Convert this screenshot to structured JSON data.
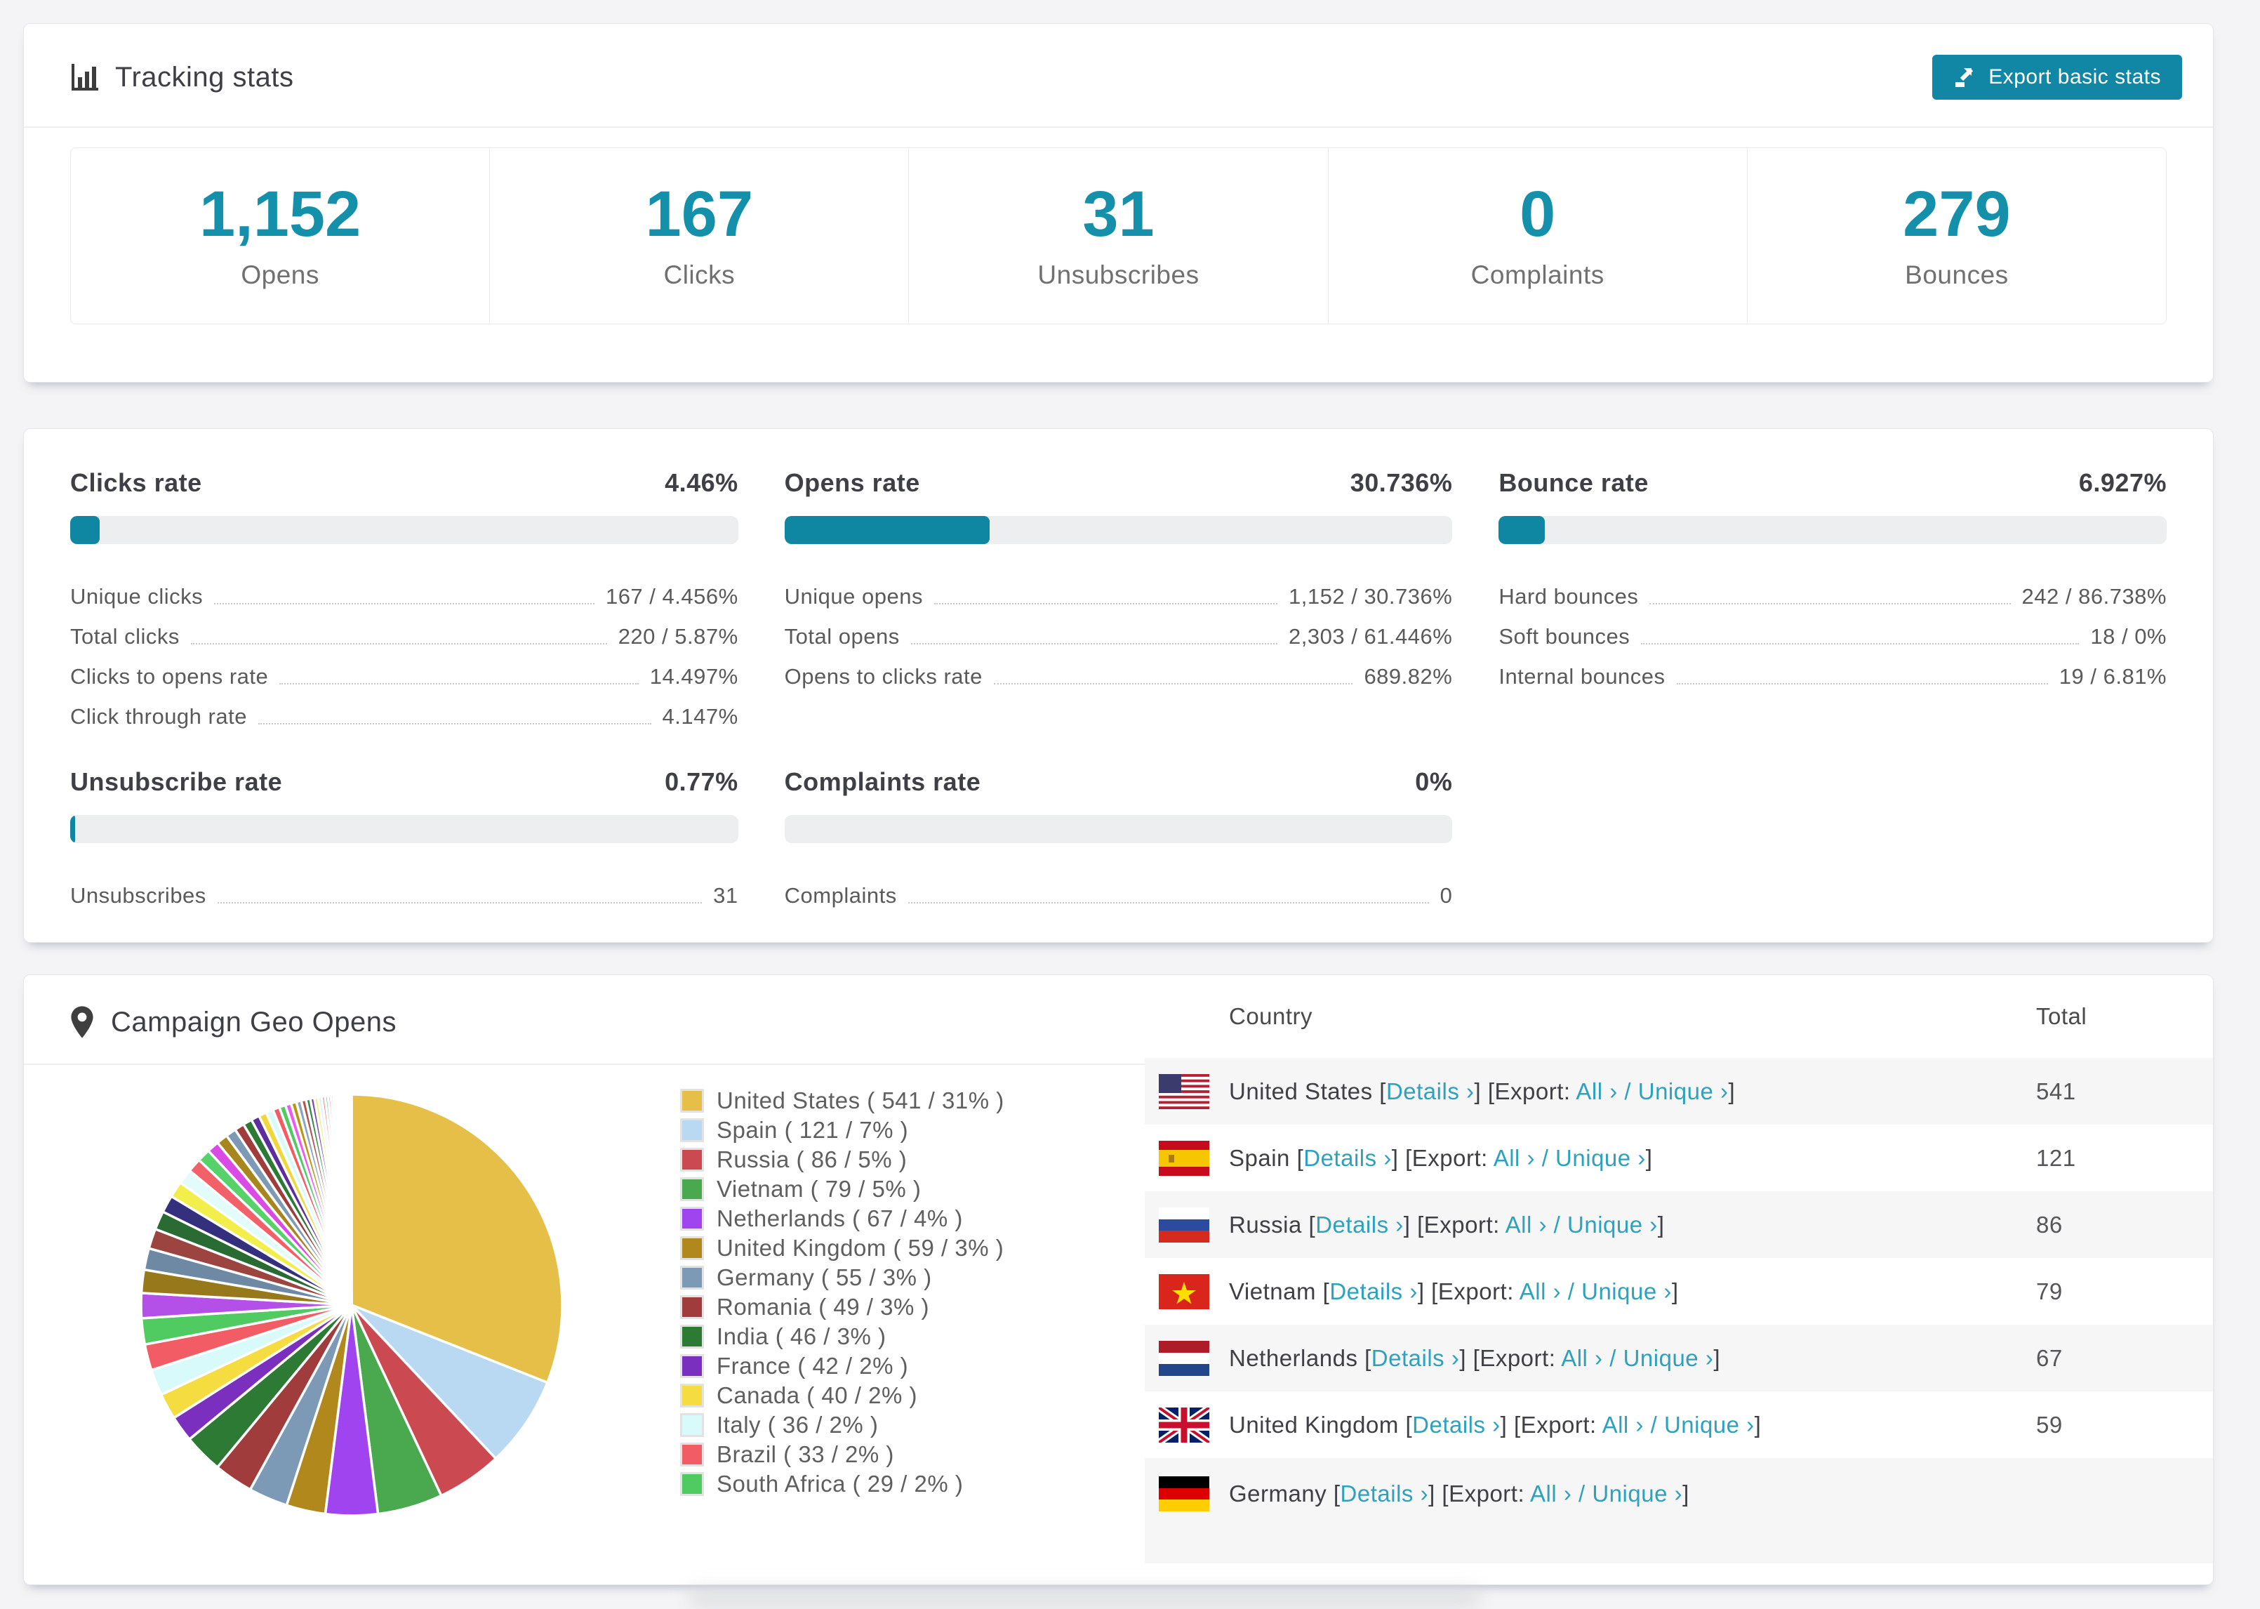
{
  "accent": {
    "teal_number": "#1590ab",
    "teal_button": "#1187a5",
    "teal_link": "#2ea1bd",
    "bar_fill": "#0f87a3",
    "bar_track": "#eceef0"
  },
  "tracking": {
    "title": "Tracking stats",
    "export_button": "Export basic stats",
    "stats": [
      {
        "value": "1,152",
        "label": "Opens"
      },
      {
        "value": "167",
        "label": "Clicks"
      },
      {
        "value": "31",
        "label": "Unsubscribes"
      },
      {
        "value": "0",
        "label": "Complaints"
      },
      {
        "value": "279",
        "label": "Bounces"
      }
    ]
  },
  "rates": {
    "clicks": {
      "title": "Clicks rate",
      "value": "4.46%",
      "percent": 4.46,
      "rows": [
        [
          "Unique clicks",
          "167 / 4.456%"
        ],
        [
          "Total clicks",
          "220 / 5.87%"
        ],
        [
          "Clicks to opens rate",
          "14.497%"
        ],
        [
          "Click through rate",
          "4.147%"
        ]
      ]
    },
    "opens": {
      "title": "Opens rate",
      "value": "30.736%",
      "percent": 30.736,
      "rows": [
        [
          "Unique opens",
          "1,152 / 30.736%"
        ],
        [
          "Total opens",
          "2,303 / 61.446%"
        ],
        [
          "Opens to clicks rate",
          "689.82%"
        ]
      ]
    },
    "bounce": {
      "title": "Bounce rate",
      "value": "6.927%",
      "percent": 6.927,
      "rows": [
        [
          "Hard bounces",
          "242 / 86.738%"
        ],
        [
          "Soft bounces",
          "18 / 0%"
        ],
        [
          "Internal bounces",
          "19 / 6.81%"
        ]
      ]
    },
    "unsubscribe": {
      "title": "Unsubscribe rate",
      "value": "0.77%",
      "percent": 0.77,
      "rows": [
        [
          "Unsubscribes",
          "31"
        ]
      ]
    },
    "complaints": {
      "title": "Complaints rate",
      "value": "0%",
      "percent": 0,
      "rows": [
        [
          "Complaints",
          "0"
        ]
      ]
    }
  },
  "geo": {
    "title": "Campaign Geo Opens",
    "table": {
      "columns": [
        "Country",
        "Total"
      ],
      "link_labels": {
        "details": "Details ›",
        "export_prefix": "[Export:",
        "all": "All ›",
        "unique": "Unique ›",
        "slash": "/"
      },
      "rows": [
        {
          "country": "United States",
          "flag": "us",
          "total": "541"
        },
        {
          "country": "Spain",
          "flag": "es",
          "total": "121"
        },
        {
          "country": "Russia",
          "flag": "ru",
          "total": "86"
        },
        {
          "country": "Vietnam",
          "flag": "vn",
          "total": "79"
        },
        {
          "country": "Netherlands",
          "flag": "nl",
          "total": "67"
        },
        {
          "country": "United Kingdom",
          "flag": "gb",
          "total": "59"
        },
        {
          "country": "Germany",
          "flag": "de",
          "total": "",
          "partial": true
        }
      ]
    }
  },
  "chart_data": {
    "type": "pie",
    "title": "Campaign Geo Opens",
    "unit": "opens",
    "legend_position": "right",
    "slices": [
      {
        "name": "United States",
        "value": 541,
        "pct": 31,
        "color": "#e5bf47"
      },
      {
        "name": "Spain",
        "value": 121,
        "pct": 7,
        "color": "#b9d9f2"
      },
      {
        "name": "Russia",
        "value": 86,
        "pct": 5,
        "color": "#cb4a52"
      },
      {
        "name": "Vietnam",
        "value": 79,
        "pct": 5,
        "color": "#4aa84f"
      },
      {
        "name": "Netherlands",
        "value": 67,
        "pct": 4,
        "color": "#a044ef"
      },
      {
        "name": "United Kingdom",
        "value": 59,
        "pct": 3,
        "color": "#b0881c"
      },
      {
        "name": "Germany",
        "value": 55,
        "pct": 3,
        "color": "#7c9ab5"
      },
      {
        "name": "Romania",
        "value": 49,
        "pct": 3,
        "color": "#a03c3c"
      },
      {
        "name": "India",
        "value": 46,
        "pct": 3,
        "color": "#2d7a35"
      },
      {
        "name": "France",
        "value": 42,
        "pct": 2,
        "color": "#7b2fbe"
      },
      {
        "name": "Canada",
        "value": 40,
        "pct": 2,
        "color": "#f5dc40"
      },
      {
        "name": "Italy",
        "value": 36,
        "pct": 2,
        "color": "#d8fafa"
      },
      {
        "name": "Brazil",
        "value": 33,
        "pct": 2,
        "color": "#f25c64"
      },
      {
        "name": "South Africa",
        "value": 29,
        "pct": 2,
        "color": "#4fcb62"
      }
    ],
    "others_tail": {
      "total_percent": 26,
      "count": 42,
      "decay": 0.93,
      "palette": [
        "#b44fe8",
        "#97781b",
        "#6e89a3",
        "#9c4440",
        "#2a6b33",
        "#35307d",
        "#f2ee4b",
        "#e2fbfb",
        "#f2606a",
        "#57d169",
        "#da4ae4",
        "#a8861e",
        "#7c9ab5",
        "#a03c3c",
        "#2d7a35",
        "#5b2d9e",
        "#f0d73e",
        "#d8fafa",
        "#f25c64",
        "#4fcb62",
        "#e85cf0",
        "#b8960f",
        "#8aa6c0",
        "#b05550",
        "#3a8a46",
        "#7446bb",
        "#f5ef68",
        "#ccf5f5",
        "#f87f88",
        "#6fdc80",
        "#ef74f7",
        "#c9a822",
        "#9db5cc",
        "#c46a64",
        "#55a560",
        "#8d64cc",
        "#f7f28a",
        "#bff0f0",
        "#fb98a0",
        "#8ce89a",
        "#f58cfb",
        "#d7b92e"
      ]
    }
  }
}
